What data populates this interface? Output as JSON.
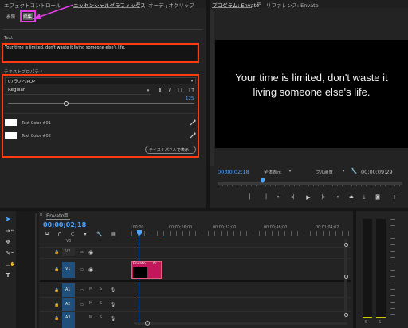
{
  "tabs": {
    "effects": "エフェクトコントロール",
    "essential": "エッセンシャルグラフィックス",
    "menu_icon": "≡",
    "audio_clip": "オーディオクリップ",
    "program": "プログラム: Envato",
    "reference": "リファレンス: Envato"
  },
  "eg": {
    "browse": "参照",
    "edit": "編集",
    "text_label": "Text",
    "text_value": "Your time is limited, don't waste it living someone else's life.",
    "text_props": "テキストプロパティ",
    "font": "07ラノベPOP",
    "style": "Regular",
    "size_value": "125",
    "color1": "Text Color #01",
    "color2": "Text Color #02",
    "show_panel": "テキストパネルで表示",
    "style_buttons": [
      "T",
      "T",
      "TT",
      "Tт"
    ]
  },
  "program": {
    "line1": "Your time is limited, don't waste it",
    "line2": "living someone else's life.",
    "timecode": "00;00;02;18",
    "fit": "全体表示",
    "resolution": "フル画質",
    "duration": "00;00;09;29"
  },
  "timeline": {
    "seq_name": "Envato",
    "timecode": "00;00;02;18",
    "ruler": [
      ":00;00",
      "00;00;16;00",
      "00;00;32;00",
      "00;00;48;00",
      "00;01;04;02"
    ],
    "tracks": [
      "V3",
      "V2",
      "V1",
      "A1",
      "A2",
      "A3"
    ],
    "clip_label": "Envato",
    "m": "M",
    "s": "S"
  },
  "meter": {
    "labels": [
      "S",
      "S"
    ]
  },
  "colors": {
    "accent_blue": "#4aa3ff",
    "highlight": "#e23ee6",
    "redbox": "#ff3b12",
    "clip": "#c2185b"
  }
}
